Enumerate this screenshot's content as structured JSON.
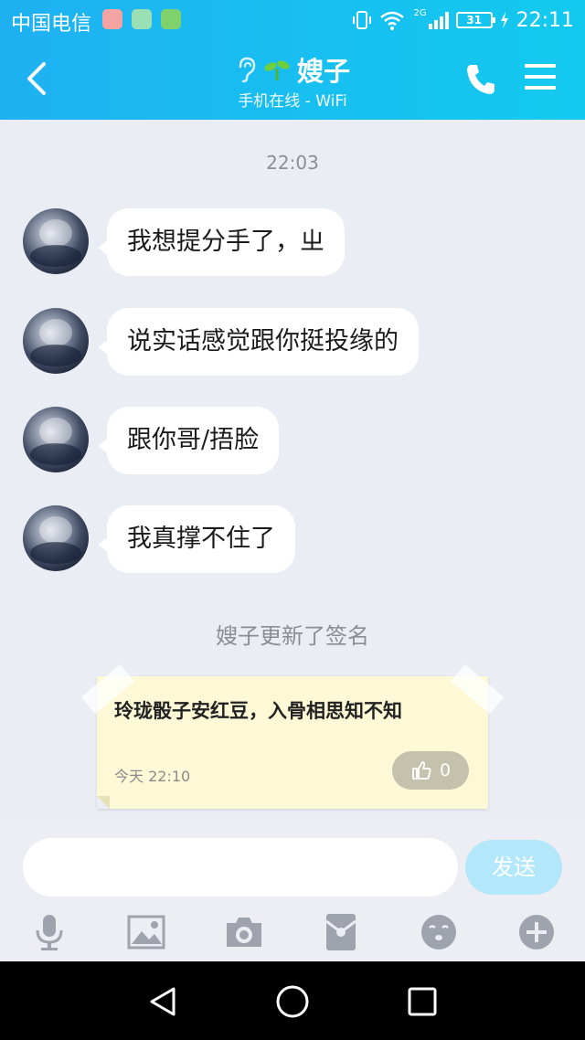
{
  "status_bar": {
    "carrier": "中国电信",
    "network": "2G",
    "battery": "31",
    "time": "22:11"
  },
  "header": {
    "title": "嫂子",
    "subtitle": "手机在线 - WiFi"
  },
  "chat": {
    "timestamp": "22:03",
    "messages": [
      {
        "text": "我想提分手了，ㄓ"
      },
      {
        "text": "说实话感觉跟你挺投缘的"
      },
      {
        "text": "跟你哥/捂脸"
      },
      {
        "text": "我真撑不住了"
      }
    ],
    "notice": "嫂子更新了签名",
    "signature": {
      "text": "玲珑骰子安红豆，入骨相思知不知",
      "time": "今天 22:10",
      "likes": "0"
    }
  },
  "composer": {
    "input_value": "",
    "send_label": "发送"
  },
  "colors": {
    "header_gradient_start": "#1fb0f2",
    "header_gradient_end": "#13c9ee",
    "chat_background": "#eaedf4",
    "bubble": "#ffffff",
    "send_button": "#b2e8fa",
    "signature_card": "#fdf9d6",
    "toolbar_icon": "#9ea3ad"
  },
  "icons": {
    "toolbar": [
      "microphone-icon",
      "image-icon",
      "camera-icon",
      "red-packet-icon",
      "emoji-icon",
      "plus-icon"
    ],
    "header": [
      "back-arrow-icon",
      "ear-icon",
      "sprout-icon",
      "phone-icon",
      "menu-icon"
    ],
    "navigation": [
      "nav-back-icon",
      "nav-home-icon",
      "nav-recents-icon"
    ]
  }
}
